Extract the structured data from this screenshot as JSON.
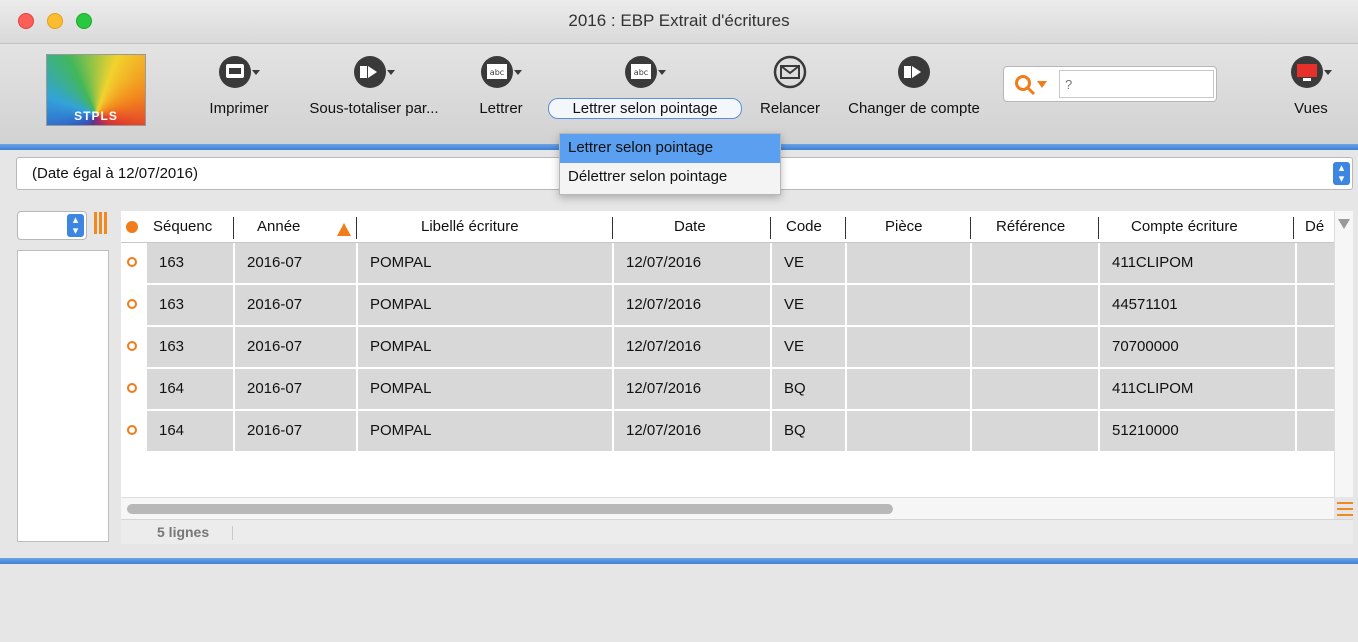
{
  "window": {
    "title": "2016 : EBP Extrait d'écritures"
  },
  "logo": {
    "text": "STPLS"
  },
  "toolbar": {
    "print_label": "Imprimer",
    "subtotal_label": "Sous-totaliser par...",
    "letter_label": "Lettrer",
    "letter_by_check_label": "Lettrer selon pointage",
    "remind_label": "Relancer",
    "change_account_label": "Changer de compte",
    "views_label": "Vues",
    "search_placeholder": "?"
  },
  "dropdown": {
    "items": [
      {
        "label": "Lettrer selon pointage",
        "selected": true
      },
      {
        "label": "Délettrer selon pointage",
        "selected": false
      }
    ]
  },
  "filter": {
    "text": "(Date égal à 12/07/2016)"
  },
  "table": {
    "columns": [
      "Séquenc",
      "Année",
      "Libellé écriture",
      "Date",
      "Code",
      "Pièce",
      "Référence",
      "Compte écriture",
      "Dé"
    ],
    "rows": [
      {
        "sequence": "163",
        "annee": "2016-07",
        "libelle": "POMPAL",
        "date": "12/07/2016",
        "code": "VE",
        "piece": "",
        "reference": "",
        "compte": "411CLIPOM"
      },
      {
        "sequence": "163",
        "annee": "2016-07",
        "libelle": "POMPAL",
        "date": "12/07/2016",
        "code": "VE",
        "piece": "",
        "reference": "",
        "compte": "44571101"
      },
      {
        "sequence": "163",
        "annee": "2016-07",
        "libelle": "POMPAL",
        "date": "12/07/2016",
        "code": "VE",
        "piece": "",
        "reference": "",
        "compte": "70700000"
      },
      {
        "sequence": "164",
        "annee": "2016-07",
        "libelle": "POMPAL",
        "date": "12/07/2016",
        "code": "BQ",
        "piece": "",
        "reference": "",
        "compte": "411CLIPOM"
      },
      {
        "sequence": "164",
        "annee": "2016-07",
        "libelle": "POMPAL",
        "date": "12/07/2016",
        "code": "BQ",
        "piece": "",
        "reference": "",
        "compte": "51210000"
      }
    ]
  },
  "status": {
    "line_count": "5 lignes"
  },
  "colors": {
    "accent_blue": "#3f7fd3",
    "accent_orange": "#f07c1a",
    "row_background": "#d8d8d8"
  }
}
